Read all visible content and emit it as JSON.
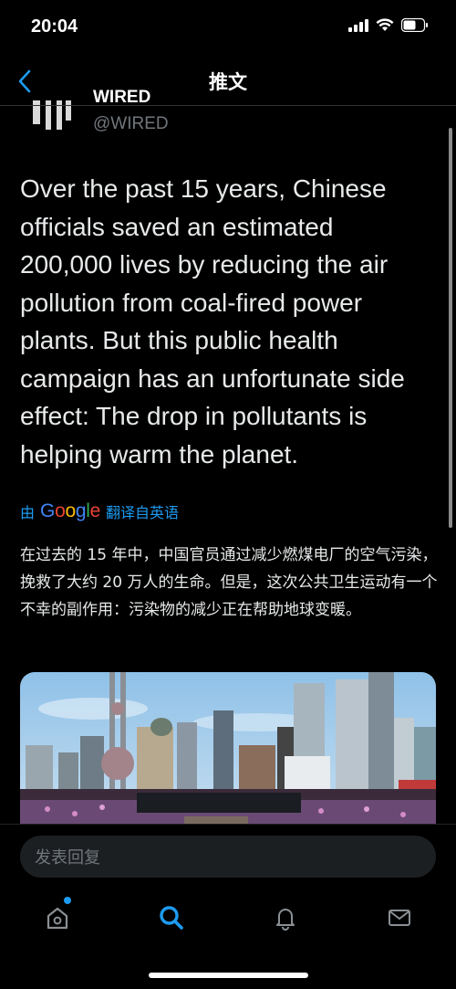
{
  "status_bar": {
    "time": "20:04"
  },
  "nav": {
    "title": "推文"
  },
  "author": {
    "name": "WIRED",
    "handle": "@WIRED"
  },
  "tweet": {
    "text": "Over the past 15 years, Chinese officials saved an estimated 200,000 lives by reducing the air pollution from coal-fired power plants. But this public health campaign has an unfortunate side effect: The drop in pollutants is helping warm the planet.",
    "translated_prefix": "由",
    "translated_brand": "Google",
    "translated_suffix": "翻译自英语",
    "translation": "在过去的 15 年中，中国官员通过减少燃煤电厂的空气污染，挽救了大约 20 万人的生命。但是，这次公共卫生运动有一个不幸的副作用：污染物的减少正在帮助地球变暖。"
  },
  "reply": {
    "placeholder": "发表回复"
  },
  "tabs": [
    "home-icon",
    "search-icon",
    "notifications-icon",
    "messages-icon"
  ],
  "colors": {
    "accent": "#1d9bf0",
    "background": "#000000",
    "muted": "#71767b"
  }
}
